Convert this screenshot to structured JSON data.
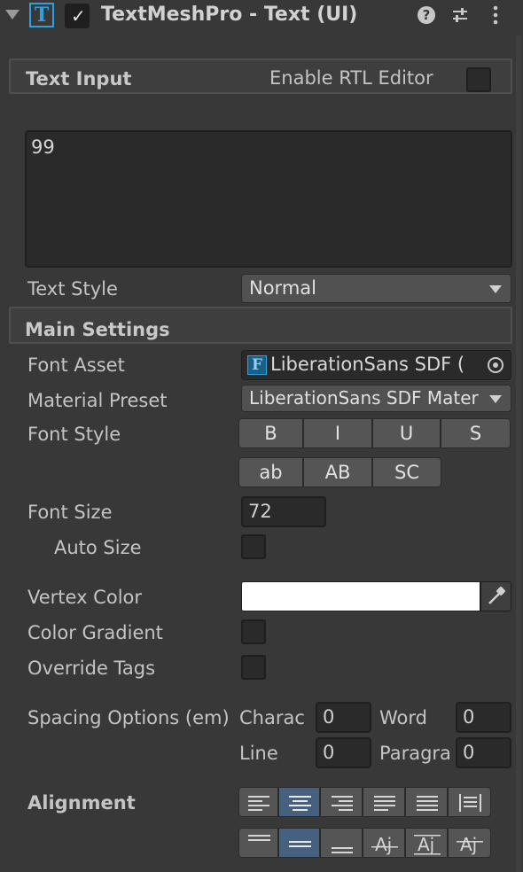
{
  "component": {
    "title": "TextMeshPro - Text (UI)",
    "enabled": true,
    "header_icons": [
      "help-icon",
      "preset-icon",
      "more-icon"
    ]
  },
  "text_input": {
    "section_title": "Text Input",
    "rtl_label": "Enable RTL Editor",
    "text_value": "99"
  },
  "text_style": {
    "label": "Text Style",
    "value": "Normal"
  },
  "main_settings": {
    "section_title": "Main Settings",
    "font_asset": {
      "label": "Font Asset",
      "value": "LiberationSans SDF ("
    },
    "material_preset": {
      "label": "Material Preset",
      "value": "LiberationSans SDF Mater"
    },
    "font_style": {
      "label": "Font Style",
      "buttons_row1": [
        "B",
        "I",
        "U",
        "S"
      ],
      "buttons_row2": [
        "ab",
        "AB",
        "SC"
      ]
    },
    "font_size": {
      "label": "Font Size",
      "value": "72"
    },
    "auto_size": {
      "label": "Auto Size"
    },
    "vertex_color": {
      "label": "Vertex Color",
      "value": "#ffffff"
    },
    "color_gradient": {
      "label": "Color Gradient"
    },
    "override_tags": {
      "label": "Override Tags"
    },
    "spacing": {
      "label": "Spacing Options (em)",
      "character_label": "Charac",
      "character_value": "0",
      "word_label": "Word",
      "word_value": "0",
      "line_label": "Line",
      "line_value": "0",
      "paragraph_label": "Paragra",
      "paragraph_value": "0"
    },
    "alignment": {
      "label": "Alignment"
    }
  },
  "colors": {
    "background": "#383838",
    "accent_active": "#46607f",
    "tmp_icon": "#2f9fe0"
  }
}
